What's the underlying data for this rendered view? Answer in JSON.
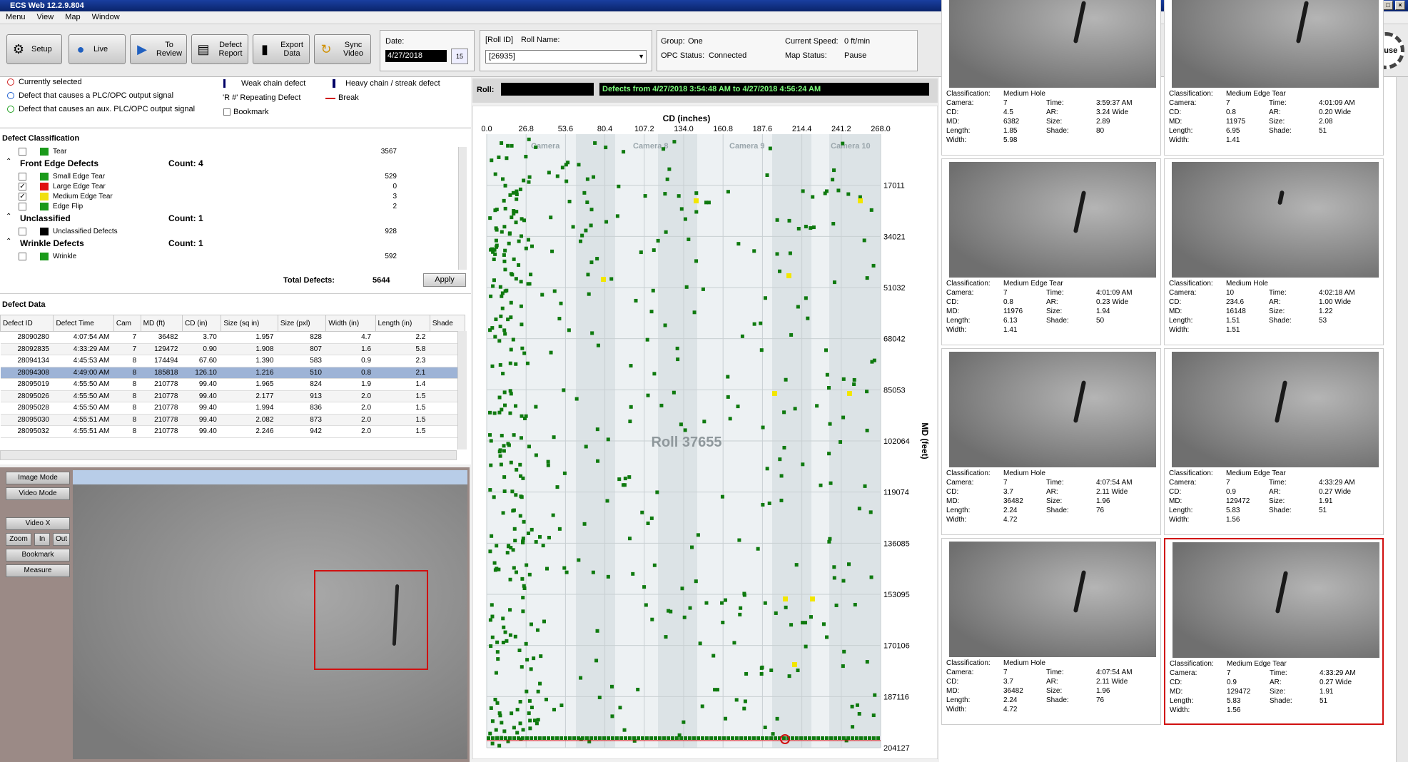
{
  "app": {
    "title": "ECS Web 12.2.9.804"
  },
  "menu": [
    "Menu",
    "View",
    "Map",
    "Window"
  ],
  "toolbar": {
    "buttons": [
      {
        "label": "Setup"
      },
      {
        "label": "Live"
      },
      {
        "label": "To Review"
      },
      {
        "label": "Defect Report"
      },
      {
        "label": "Export Data"
      },
      {
        "label": "Sync Video"
      }
    ],
    "date_label": "Date:",
    "date_value": "4/27/2018",
    "calendar_day": "15",
    "roll_id_label": "[Roll ID]",
    "roll_name_label": "Roll Name:",
    "roll_value": "[26935]",
    "group_label": "Group:",
    "group_value": "One",
    "opc_label": "OPC Status:",
    "opc_value": "Connected",
    "speed_label": "Current Speed:",
    "speed_value": "0 ft/min",
    "map_status_label": "Map Status:",
    "map_status_value": "Pause",
    "pause_label": "Pause"
  },
  "legend": {
    "currently_selected": "Currently selected",
    "plc_output": "Defect that causes a PLC/OPC output signal",
    "aux_output": "Defect that causes an aux. PLC/OPC output signal",
    "weak_chain": "Weak chain defect",
    "heavy_chain": "Heavy chain / streak defect",
    "repeating": "'R #' Repeating Defect",
    "break": "Break",
    "bookmark": "Bookmark"
  },
  "classification": {
    "title": "Defect Classification",
    "rows": [
      {
        "type": "item",
        "name": "Tear",
        "count": "3567",
        "color": "#1a9a1a",
        "checked": false
      },
      {
        "type": "group",
        "name": "Front Edge Defects",
        "count": "Count: 4"
      },
      {
        "type": "item",
        "name": "Small Edge Tear",
        "count": "529",
        "color": "#1a9a1a",
        "checked": false
      },
      {
        "type": "item",
        "name": "Large Edge Tear",
        "count": "0",
        "color": "#e01010",
        "checked": true
      },
      {
        "type": "item",
        "name": "Medium Edge Tear",
        "count": "3",
        "color": "#f0e010",
        "checked": true
      },
      {
        "type": "item",
        "name": "Edge Flip",
        "count": "2",
        "color": "#1a9a1a",
        "checked": false
      },
      {
        "type": "group",
        "name": "Unclassified",
        "count": "Count: 1"
      },
      {
        "type": "item",
        "name": "Unclassified Defects",
        "count": "928",
        "color": "#000000",
        "checked": false
      },
      {
        "type": "group",
        "name": "Wrinkle Defects",
        "count": "Count: 1"
      },
      {
        "type": "item",
        "name": "Wrinkle",
        "count": "592",
        "color": "#1a9a1a",
        "checked": false
      }
    ],
    "total_label": "Total Defects:",
    "total_value": "5644",
    "apply_label": "Apply"
  },
  "defect_data": {
    "title": "Defect Data",
    "columns": [
      "Defect ID",
      "Defect Time",
      "Cam",
      "MD (ft)",
      "CD (in)",
      "Size (sq in)",
      "Size (pxl)",
      "Width (in)",
      "Length (in)",
      "Shade"
    ],
    "rows": [
      [
        "28090280",
        "4:07:54 AM",
        "7",
        "36482",
        "3.70",
        "1.957",
        "828",
        "4.7",
        "2.2"
      ],
      [
        "28092835",
        "4:33:29 AM",
        "7",
        "129472",
        "0.90",
        "1.908",
        "807",
        "1.6",
        "5.8"
      ],
      [
        "28094134",
        "4:45:53 AM",
        "8",
        "174494",
        "67.60",
        "1.390",
        "583",
        "0.9",
        "2.3"
      ],
      [
        "28094308",
        "4:49:00 AM",
        "8",
        "185818",
        "126.10",
        "1.216",
        "510",
        "0.8",
        "2.1"
      ],
      [
        "28095019",
        "4:55:50 AM",
        "8",
        "210778",
        "99.40",
        "1.965",
        "824",
        "1.9",
        "1.4"
      ],
      [
        "28095026",
        "4:55:50 AM",
        "8",
        "210778",
        "99.40",
        "2.177",
        "913",
        "2.0",
        "1.5"
      ],
      [
        "28095028",
        "4:55:50 AM",
        "8",
        "210778",
        "99.40",
        "1.994",
        "836",
        "2.0",
        "1.5"
      ],
      [
        "28095030",
        "4:55:51 AM",
        "8",
        "210778",
        "99.40",
        "2.082",
        "873",
        "2.0",
        "1.5"
      ],
      [
        "28095032",
        "4:55:51 AM",
        "8",
        "210778",
        "99.40",
        "2.246",
        "942",
        "2.0",
        "1.5"
      ]
    ],
    "selected_row": 3
  },
  "image_panel": {
    "buttons": [
      "Image Mode",
      "Video Mode",
      "Video X",
      "Zoom",
      "In",
      "Out",
      "Bookmark",
      "Measure"
    ]
  },
  "map": {
    "roll_label": "Roll:",
    "range_text": "Defects from 4/27/2018 3:54:48 AM to 4/27/2018 4:56:24 AM",
    "cd_label": "CD (inches)",
    "md_label": "MD (feet)",
    "watermark": "Roll 37655",
    "cd_ticks": [
      "0.0",
      "26.8",
      "53.6",
      "80.4",
      "107.2",
      "134.0",
      "160.8",
      "187.6",
      "214.4",
      "241.2",
      "268.0"
    ],
    "md_ticks": [
      "17011",
      "34021",
      "51032",
      "68042",
      "85053",
      "102064",
      "119074",
      "136085",
      "153095",
      "170106",
      "187116",
      "204127"
    ],
    "cameras": [
      "Camera",
      "Camera 8",
      "Camera 9",
      "Camera 10"
    ]
  },
  "thumbnails": [
    {
      "classification": "Medium Hole",
      "camera": "7",
      "time": "3:59:37 AM",
      "cd": "4.5",
      "ar": "3.24 Wide",
      "md": "6382",
      "size": "2.89",
      "length": "1.85",
      "shade": "80",
      "width": "5.98"
    },
    {
      "classification": "Medium Edge Tear",
      "camera": "7",
      "time": "4:01:09 AM",
      "cd": "0.8",
      "ar": "0.20 Wide",
      "md": "11975",
      "size": "2.08",
      "length": "6.95",
      "shade": "51",
      "width": "1.41"
    },
    {
      "classification": "Medium Edge Tear",
      "camera": "7",
      "time": "4:01:09 AM",
      "cd": "0.8",
      "ar": "0.23 Wide",
      "md": "11976",
      "size": "1.94",
      "length": "6.13",
      "shade": "50",
      "width": "1.41"
    },
    {
      "classification": "Medium Hole",
      "camera": "10",
      "time": "4:02:18 AM",
      "cd": "234.6",
      "ar": "1.00 Wide",
      "md": "16148",
      "size": "1.22",
      "length": "1.51",
      "shade": "53",
      "width": "1.51"
    },
    {
      "classification": "Medium Hole",
      "camera": "7",
      "time": "4:07:54 AM",
      "cd": "3.7",
      "ar": "2.11 Wide",
      "md": "36482",
      "size": "1.96",
      "length": "2.24",
      "shade": "76",
      "width": "4.72"
    },
    {
      "classification": "Medium Edge Tear",
      "camera": "7",
      "time": "4:33:29 AM",
      "cd": "0.9",
      "ar": "0.27 Wide",
      "md": "129472",
      "size": "1.91",
      "length": "5.83",
      "shade": "51",
      "width": "1.56"
    },
    {
      "classification": "Medium Hole",
      "camera": "7",
      "time": "4:07:54 AM",
      "cd": "3.7",
      "ar": "2.11 Wide",
      "md": "36482",
      "size": "1.96",
      "length": "2.24",
      "shade": "76",
      "width": "4.72"
    },
    {
      "classification": "Medium Edge Tear",
      "camera": "7",
      "time": "4:33:29 AM",
      "cd": "0.9",
      "ar": "0.27 Wide",
      "md": "129472",
      "size": "1.91",
      "length": "5.83",
      "shade": "51",
      "width": "1.56"
    }
  ],
  "thumb_labels": {
    "classification": "Classification:",
    "camera": "Camera:",
    "time": "Time:",
    "cd": "CD:",
    "ar": "AR:",
    "md": "MD:",
    "size": "Size:",
    "length": "Length:",
    "shade": "Shade:",
    "width": "Width:"
  },
  "colors": {
    "defect_green": "#0f7a0f",
    "defect_yellow": "#f2e600",
    "selection_red": "#d01010",
    "title_blue": "#0a246a"
  }
}
